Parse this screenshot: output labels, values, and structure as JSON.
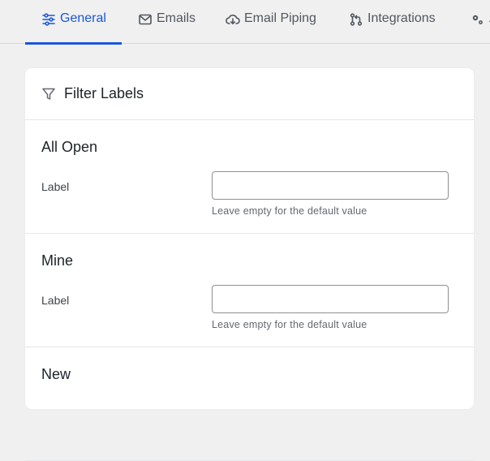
{
  "tabs": [
    {
      "label": "General",
      "icon": "sliders-icon",
      "active": true
    },
    {
      "label": "Emails",
      "icon": "envelope-icon"
    },
    {
      "label": "Email Piping",
      "icon": "cloud-download-icon"
    },
    {
      "label": "Integrations",
      "icon": "integration-icon"
    },
    {
      "label": "A",
      "icon": "gears-icon"
    }
  ],
  "card": {
    "title": "Filter Labels",
    "icon": "filter-icon",
    "sections": [
      {
        "title": "All Open",
        "field_label": "Label",
        "value": "",
        "hint": "Leave empty for the default value"
      },
      {
        "title": "Mine",
        "field_label": "Label",
        "value": "",
        "hint": "Leave empty for the default value"
      },
      {
        "title": "New"
      }
    ]
  },
  "colors": {
    "accent": "#1a56db",
    "background": "#f0f0f1",
    "card": "#ffffff"
  }
}
